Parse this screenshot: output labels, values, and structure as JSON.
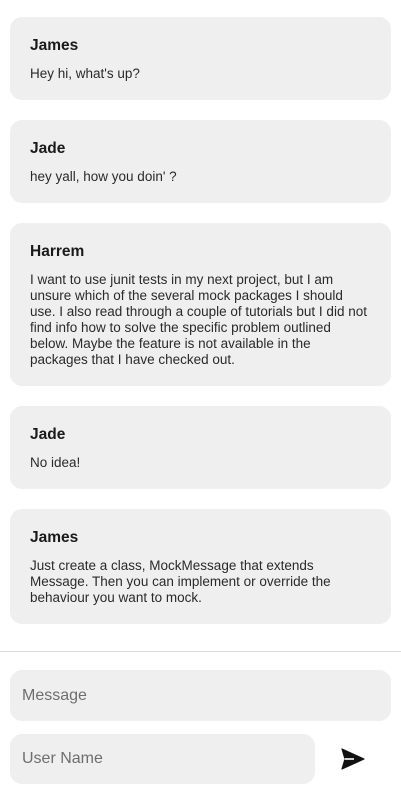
{
  "messages": [
    {
      "user": "James",
      "text": "Hey hi, what's up?"
    },
    {
      "user": "Jade",
      "text": "hey yall, how you doin' ?"
    },
    {
      "user": "Harrem",
      "text": "I want to use junit tests in my next project, but I am unsure which of the several mock packages I should use. I also read through a couple of tutorials but I did not find info how to solve the specific problem outlined below. Maybe the feature is not available in the packages that I have checked out."
    },
    {
      "user": "Jade",
      "text": "No idea!"
    },
    {
      "user": "James",
      "text": "Just create a class, MockMessage that extends Message. Then you can implement or override the behaviour you want to mock."
    }
  ],
  "composer": {
    "message_placeholder": "Message",
    "message_value": "",
    "username_placeholder": "User Name",
    "username_value": "",
    "send_icon": "send-icon"
  },
  "colors": {
    "bubble": "#efefef",
    "field": "#efefef",
    "divider": "#dcdcdc",
    "send_icon": "#111111"
  }
}
